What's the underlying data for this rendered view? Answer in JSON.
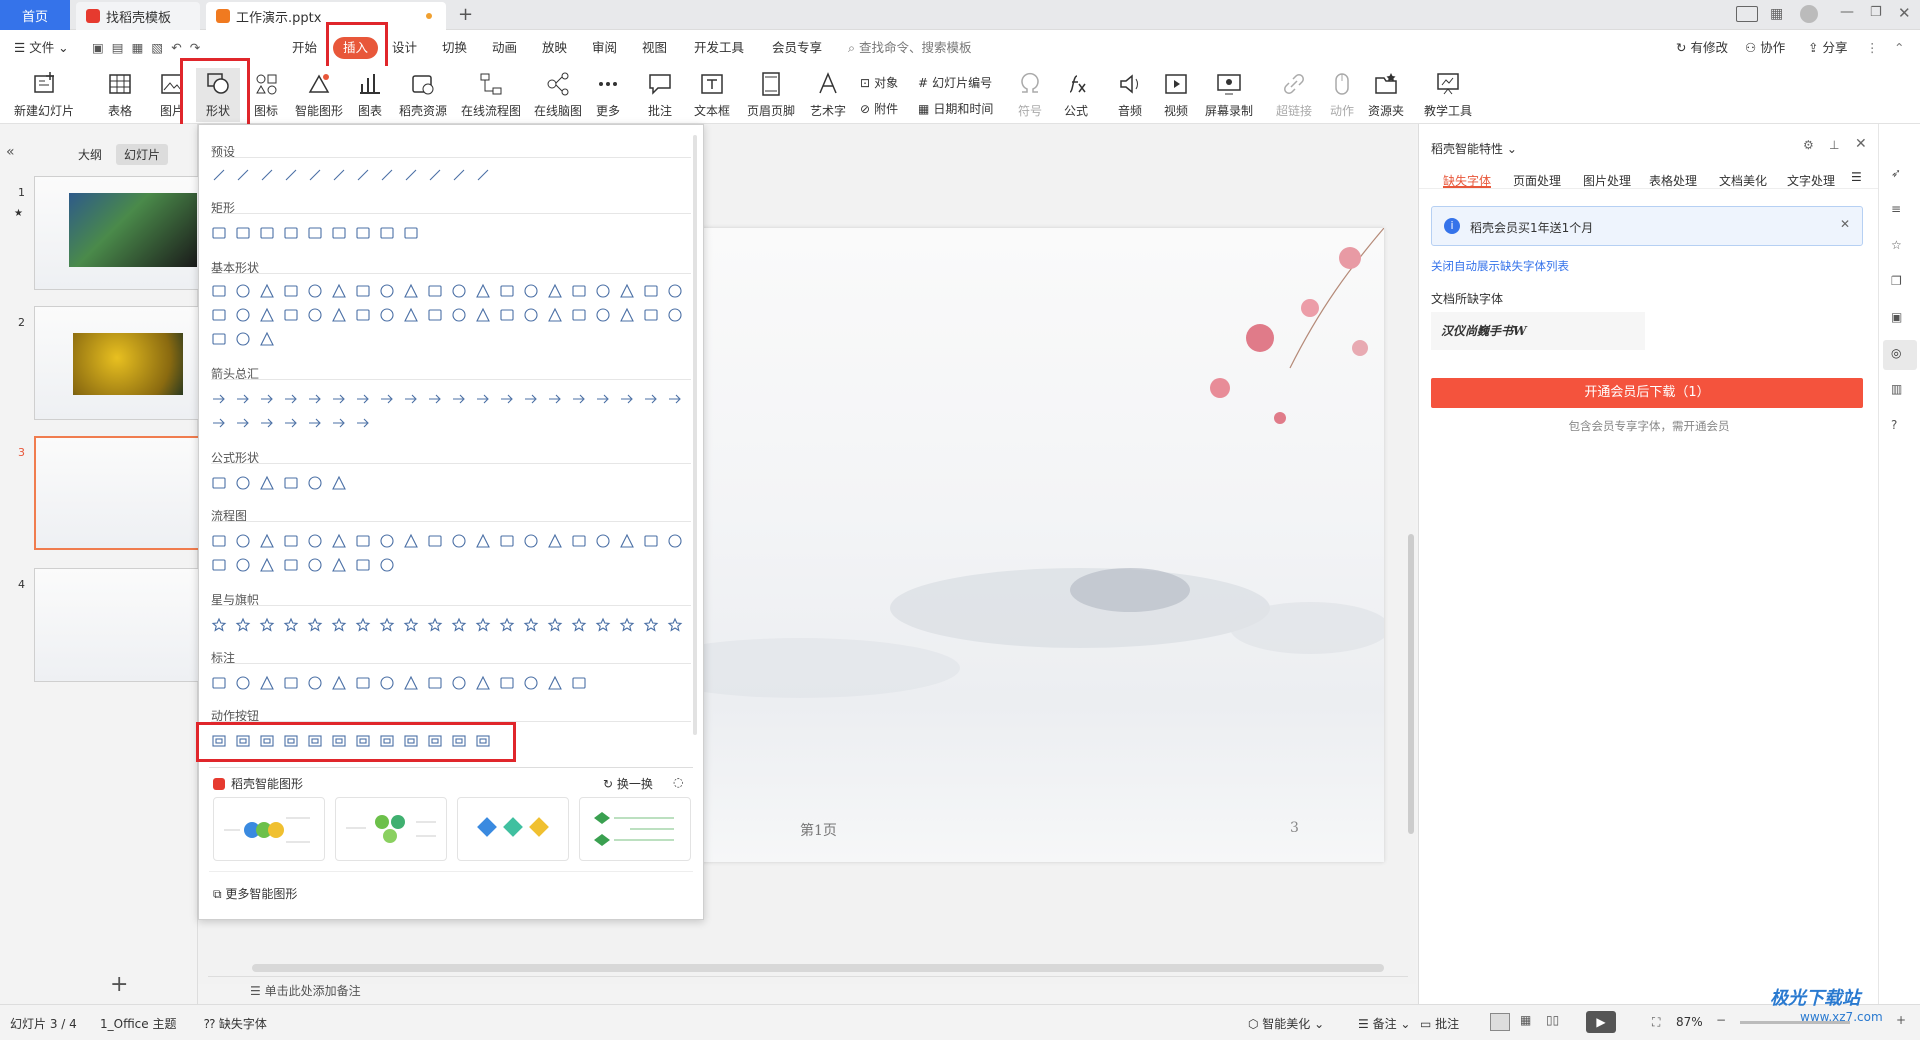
{
  "tabs": [
    {
      "label": "首页"
    },
    {
      "label": "找稻壳模板"
    },
    {
      "label": "工作演示.pptx"
    }
  ],
  "menu": {
    "file": "文件",
    "items": [
      "开始",
      "插入",
      "设计",
      "切换",
      "动画",
      "放映",
      "审阅",
      "视图",
      "开发工具",
      "会员专享"
    ],
    "search_placeholder": "查找命令、搜索模板",
    "modify": "有修改",
    "collab": "协作",
    "share": "分享"
  },
  "ribbon": {
    "new_slide": "新建幻灯片",
    "table": "表格",
    "picture": "图片",
    "shape": "形状",
    "icon": "图标",
    "smartart": "智能图形",
    "chart": "图表",
    "resource": "稻壳资源",
    "flowchart": "在线流程图",
    "mindmap": "在线脑图",
    "more": "更多",
    "comment": "批注",
    "textbox": "文本框",
    "header_footer": "页眉页脚",
    "wordart": "艺术字",
    "object": "对象",
    "attachment": "附件",
    "slide_number": "幻灯片编号",
    "datetime": "日期和时间",
    "symbol": "符号",
    "formula": "公式",
    "audio": "音频",
    "video": "视频",
    "screen_record": "屏幕录制",
    "hyperlink": "超链接",
    "action": "动作",
    "resource_folder": "资源夹",
    "teaching": "教学工具"
  },
  "left": {
    "outline_tab": "大纲",
    "slides_tab": "幻灯片",
    "slide_nums": [
      "1",
      "2",
      "3",
      "4"
    ],
    "add": "+"
  },
  "shapes": {
    "sections": [
      "预设",
      "矩形",
      "基本形状",
      "箭头总汇",
      "公式形状",
      "流程图",
      "星与旗帜",
      "标注",
      "动作按钮"
    ],
    "smart_title": "稻壳智能图形",
    "refresh": "换一换",
    "more_smart": "更多智能图形"
  },
  "slide": {
    "footer_left": "第1页",
    "footer_right": "3"
  },
  "notes": {
    "placeholder": "单击此处添加备注"
  },
  "rpanel": {
    "title": "稻壳智能特性",
    "tabs": [
      "缺失字体",
      "页面处理",
      "图片处理",
      "表格处理",
      "文档美化",
      "文字处理"
    ],
    "notice": "稻壳会员买1年送1个月",
    "link": "关闭自动展示缺失字体列表",
    "missing_label": "文档所缺字体",
    "font_sample": "汉仪尚巍手书W",
    "download_btn": "开通会员后下载（1）",
    "hint": "包含会员专享字体，需开通会员"
  },
  "status": {
    "slide_count": "幻灯片 3 / 4",
    "theme": "1_Office 主题",
    "missing_font": "缺失字体",
    "beautify": "智能美化",
    "notes": "备注",
    "comment": "批注",
    "zoom": "87%"
  },
  "watermark": {
    "text": "极光下载站",
    "url": "www.xz7.com"
  },
  "colors": {
    "accent": "#e8573a",
    "highlight": "#e0262b",
    "tab_blue": "#3573ea",
    "panel_btn": "#f4533d"
  }
}
